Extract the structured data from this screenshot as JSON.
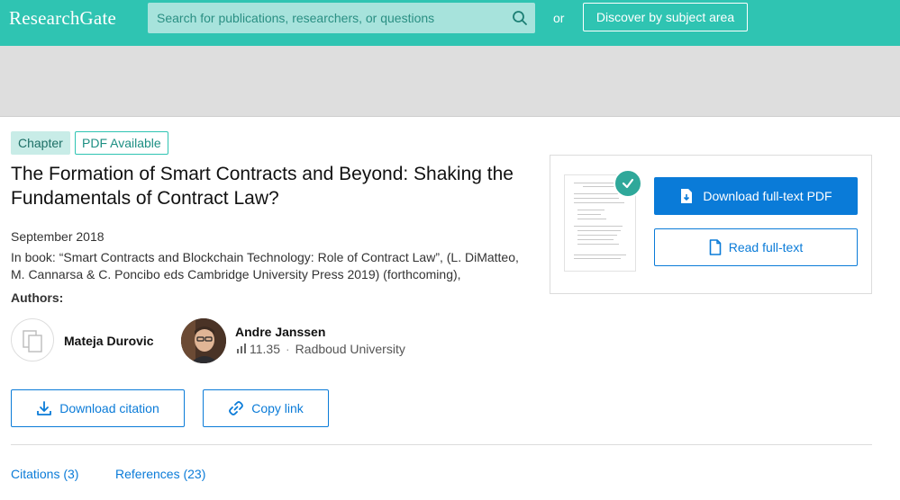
{
  "header": {
    "logo": "ResearchGate",
    "search_placeholder": "Search for publications, researchers, or questions",
    "or_label": "or",
    "discover_label": "Discover by subject area"
  },
  "publication": {
    "badges": {
      "type": "Chapter",
      "availability": "PDF Available"
    },
    "title": "The Formation of Smart Contracts and Beyond: Shaking the Fundamentals of Contract Law?",
    "date": "September 2018",
    "in_book": "In book: “Smart Contracts and Blockchain Technology: Role of Contract Law”, (L. DiMatteo, M. Cannarsa & C. Poncibo eds Cambridge University Press 2019) (forthcoming),",
    "authors_label": "Authors:",
    "authors": [
      {
        "name": "Mateja Durovic"
      },
      {
        "name": "Andre Janssen",
        "score": "11.35",
        "affiliation": "Radboud University"
      }
    ]
  },
  "actions": {
    "download_citation": "Download citation",
    "copy_link": "Copy link",
    "download_pdf": "Download full-text PDF",
    "read_full_text": "Read full-text"
  },
  "tabs": [
    {
      "label": "Citations (3)"
    },
    {
      "label": "References (23)"
    }
  ],
  "colors": {
    "brand_teal": "#2fc4b2",
    "link_blue": "#0a7bd8"
  }
}
